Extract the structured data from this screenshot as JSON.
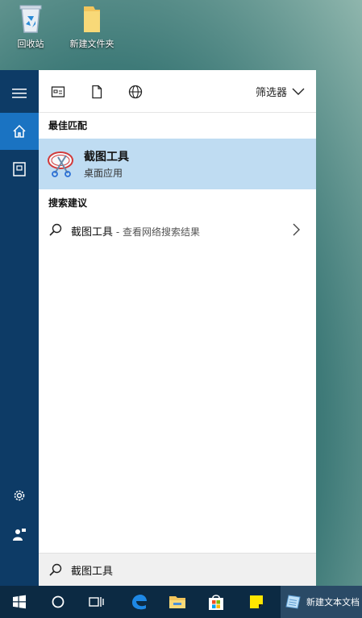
{
  "desktop": {
    "icons": [
      {
        "label": "回收站"
      },
      {
        "label": "新建文件夹"
      }
    ]
  },
  "panel": {
    "filter_label": "筛选器",
    "best_match": {
      "header": "最佳匹配",
      "title": "截图工具",
      "subtitle": "桌面应用"
    },
    "suggestions": {
      "header": "搜索建议",
      "query": "截图工具",
      "extra": " - 查看网络搜索结果"
    },
    "search_box": {
      "value": "截图工具"
    }
  },
  "taskbar": {
    "active_window_label": "新建文本文档"
  },
  "colors": {
    "rail": "#0d3b66",
    "rail_active": "#1a73c2",
    "highlight": "#bfdcf2",
    "taskbar": "#0c2a43"
  }
}
